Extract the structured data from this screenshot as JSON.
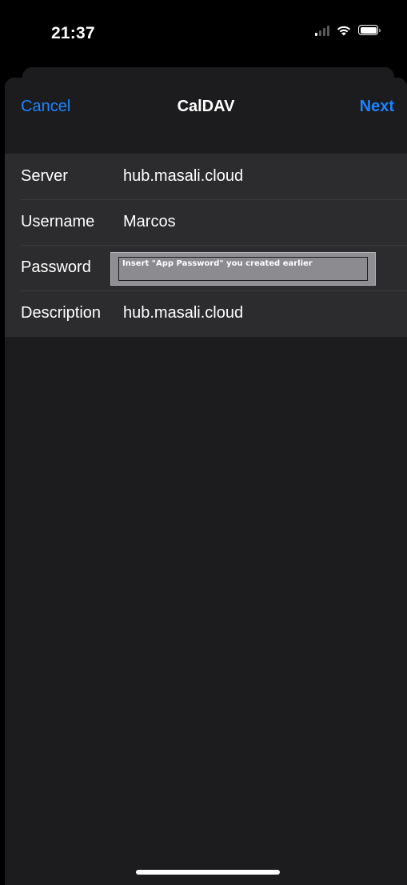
{
  "status_bar": {
    "time": "21:37",
    "icons": [
      "cellular-signal-icon",
      "wifi-icon",
      "battery-icon"
    ]
  },
  "nav": {
    "cancel_label": "Cancel",
    "title": "CalDAV",
    "next_label": "Next"
  },
  "form": {
    "rows": [
      {
        "label": "Server",
        "value": "hub.masali.cloud"
      },
      {
        "label": "Username",
        "value": "Marcos"
      },
      {
        "label": "Password",
        "value": "Insert \"App Password\" you created earlier"
      },
      {
        "label": "Description",
        "value": "hub.masali.cloud"
      }
    ]
  },
  "colors": {
    "accent": "#1a84ff",
    "background": "#000000",
    "sheet": "#1c1c1e",
    "form_background": "#2c2c2e"
  }
}
